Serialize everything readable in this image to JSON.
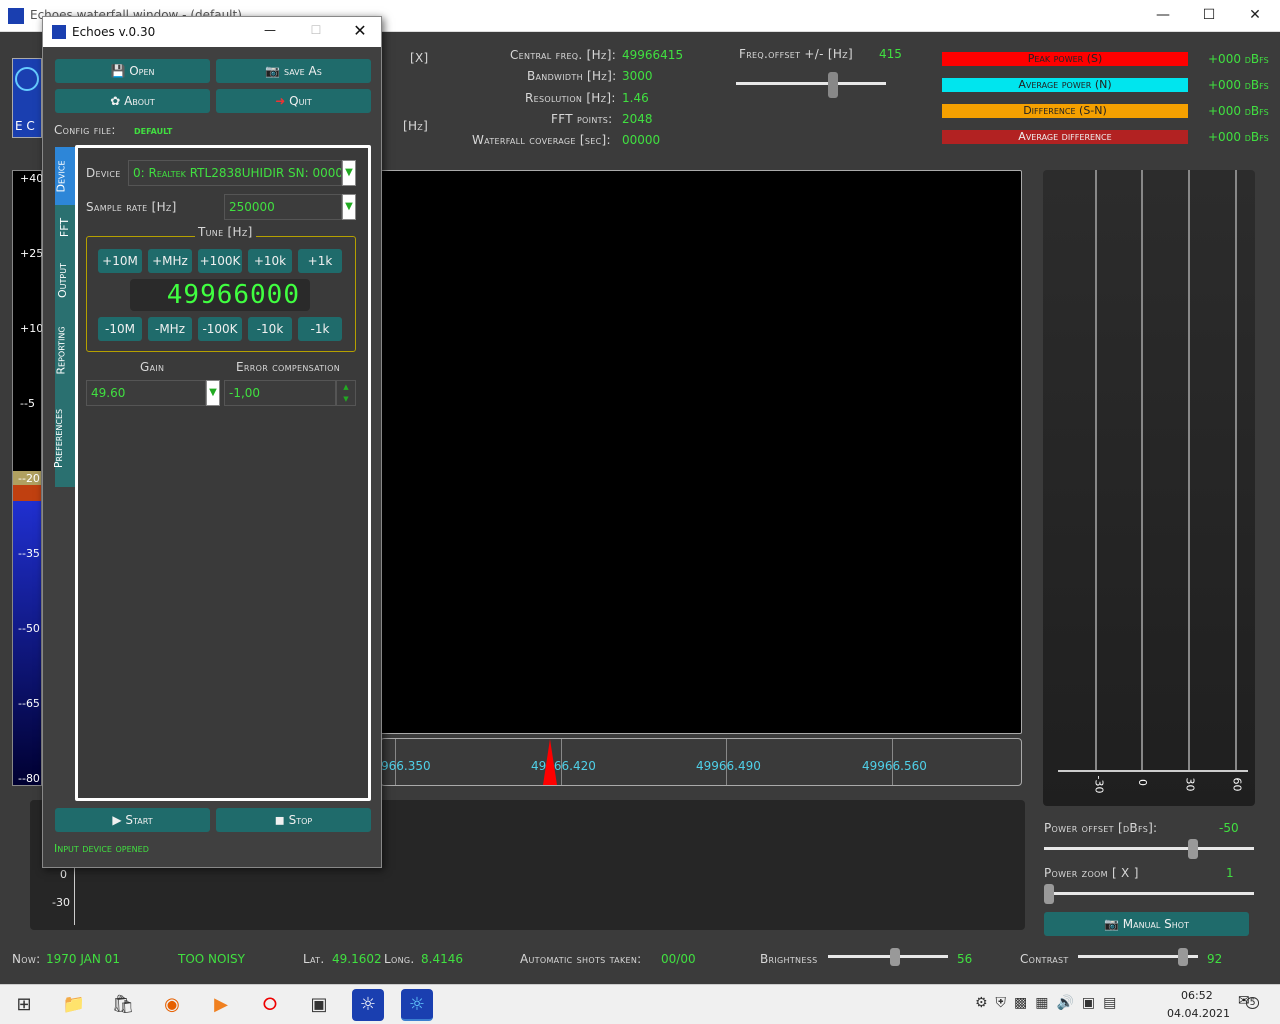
{
  "main_window": {
    "title": "Echoes waterfall window - (default)",
    "x_label": "[X]",
    "hz_label": "[Hz]"
  },
  "info": {
    "central_freq_label": "Central freq. [Hz]:",
    "central_freq_value": "49966415",
    "bandwidth_label": "Bandwidth [Hz]:",
    "bandwidth_value": "3000",
    "resolution_label": "Resolution [Hz]:",
    "resolution_value": "1.46",
    "fft_points_label": "FFT points:",
    "fft_points_value": "2048",
    "coverage_label": "Waterfall coverage [sec]:",
    "coverage_value": "00000",
    "freq_offset_label": "Freq.offset +/- [Hz]",
    "freq_offset_value": "415"
  },
  "power_bars": [
    {
      "label": "Peak power (S)",
      "value": "+000 dBfs",
      "color": "#ff0000"
    },
    {
      "label": "Average power (N)",
      "value": "+000 dBfs",
      "color": "#00e5ee"
    },
    {
      "label": "Difference (S-N)",
      "value": "+000 dBfs",
      "color": "#f5a000"
    },
    {
      "label": "Average difference",
      "value": "+000 dBfs",
      "color": "#b22222"
    }
  ],
  "left_scale": [
    "+40",
    "+25",
    "+10",
    "--5",
    "--20",
    "--35",
    "--50",
    "--65",
    "--80"
  ],
  "freq_scale": [
    "966.350",
    "49966.420",
    "49966.490",
    "49966.560"
  ],
  "right_scale": [
    "-30",
    "0",
    "30",
    "60"
  ],
  "power_graph_ticks": [
    "0",
    "-30"
  ],
  "right_controls": {
    "power_offset_label": "Power offset [dBfs]:",
    "power_offset_value": "-50",
    "power_zoom_label": "Power zoom  [ X ]",
    "power_zoom_value": "1",
    "manual_shot": "Manual Shot"
  },
  "status": {
    "now_label": "Now:",
    "now_value": "1970 JAN 01",
    "noisy": "TOO NOISY",
    "lat_label": "Lat.",
    "lat_value": "49.1602",
    "long_label": "Long.",
    "long_value": "8.4146",
    "shots_label": "Automatic shots taken:",
    "shots_value": "00/00",
    "brightness_label": "Brightness",
    "brightness_value": "56",
    "contrast_label": "Contrast",
    "contrast_value": "92"
  },
  "dialog": {
    "title": "Echoes v.0.30",
    "open": "Open",
    "save_as": "save As",
    "about": "About",
    "quit": "Quit",
    "config_label": "Config file:",
    "config_value": "default",
    "tabs": [
      "Device",
      "FFT",
      "Output",
      "Reporting",
      "Preferences"
    ],
    "device_label": "Device",
    "device_value": "0: Realtek RTL2838UHIDIR  SN: 0000",
    "sample_rate_label": "Sample rate [Hz]",
    "sample_rate_value": "250000",
    "tune_label": "Tune [Hz]",
    "tune_up": [
      "+10M",
      "+MHz",
      "+100K",
      "+10k",
      "+1k"
    ],
    "tune_down": [
      "-10M",
      "-MHz",
      "-100K",
      "-10k",
      "-1k"
    ],
    "tune_display": "49966000",
    "gain_label": "Gain",
    "gain_value": "49.60",
    "error_label": "Error compensation",
    "error_value": "-1,00",
    "start": "Start",
    "stop": "Stop",
    "status": "Input device opened"
  },
  "taskbar": {
    "time": "06:52",
    "date": "04.04.2021",
    "notif_count": "5"
  }
}
